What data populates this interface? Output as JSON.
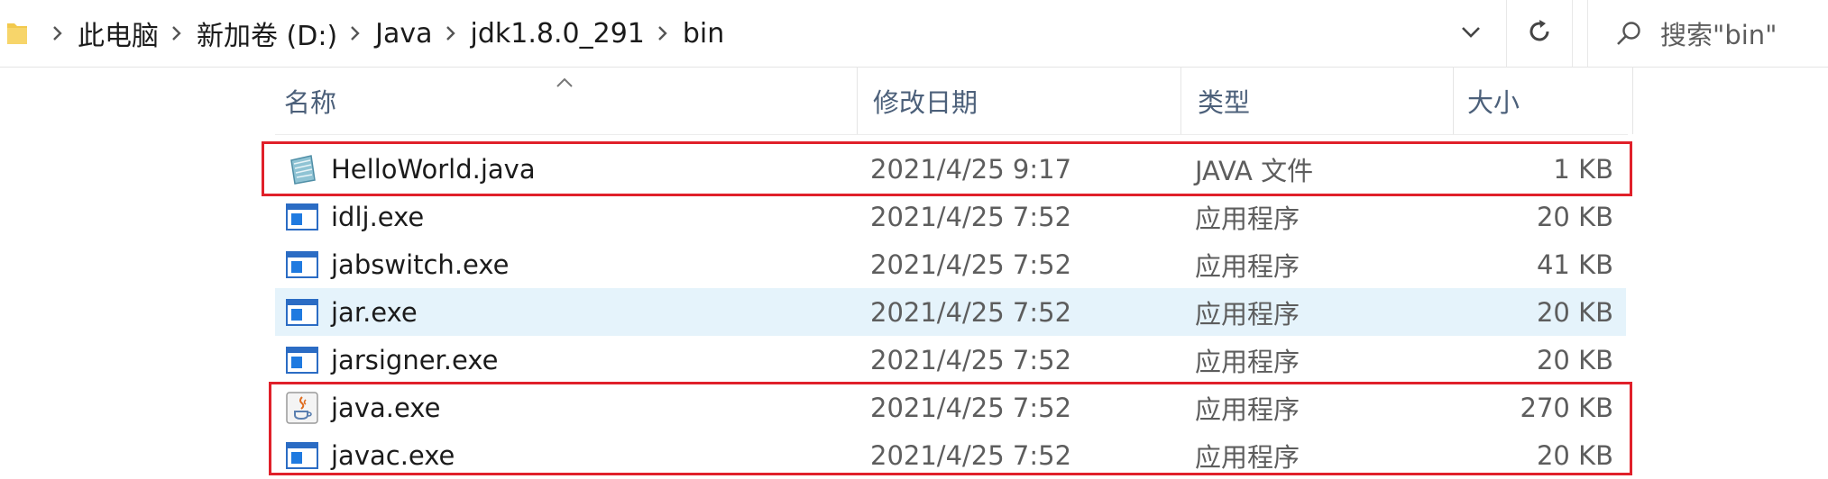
{
  "breadcrumb": {
    "items": [
      "此电脑",
      "新加卷 (D:)",
      "Java",
      "jdk1.8.0_291",
      "bin"
    ]
  },
  "search": {
    "placeholder": "搜索\"bin\""
  },
  "columns": {
    "name": "名称",
    "date": "修改日期",
    "type": "类型",
    "size": "大小"
  },
  "files": [
    {
      "name": "HelloWorld.java",
      "date": "2021/4/25 9:17",
      "type": "JAVA 文件",
      "size": "1 KB",
      "icon": "java-source-file-icon"
    },
    {
      "name": "idlj.exe",
      "date": "2021/4/25 7:52",
      "type": "应用程序",
      "size": "20 KB",
      "icon": "application-icon"
    },
    {
      "name": "jabswitch.exe",
      "date": "2021/4/25 7:52",
      "type": "应用程序",
      "size": "41 KB",
      "icon": "application-icon"
    },
    {
      "name": "jar.exe",
      "date": "2021/4/25 7:52",
      "type": "应用程序",
      "size": "20 KB",
      "icon": "application-icon"
    },
    {
      "name": "jarsigner.exe",
      "date": "2021/4/25 7:52",
      "type": "应用程序",
      "size": "20 KB",
      "icon": "application-icon"
    },
    {
      "name": "java.exe",
      "date": "2021/4/25 7:52",
      "type": "应用程序",
      "size": "270 KB",
      "icon": "java-coffee-icon"
    },
    {
      "name": "javac.exe",
      "date": "2021/4/25 7:52",
      "type": "应用程序",
      "size": "20 KB",
      "icon": "application-icon"
    }
  ],
  "colors": {
    "highlight": "#e0202a",
    "hover_row": "#e5f3fb",
    "header_text": "#4c607a"
  }
}
